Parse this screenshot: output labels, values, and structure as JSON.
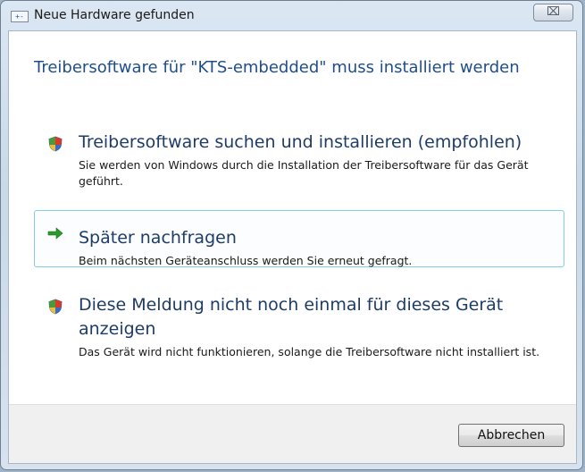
{
  "window": {
    "title": "Neue Hardware gefunden",
    "close_glyph": "⌧"
  },
  "heading": "Treibersoftware für \"KTS-embedded\" muss installiert werden",
  "options": [
    {
      "title": "Treibersoftware suchen und installieren (empfohlen)",
      "description": "Sie werden von Windows durch die Installation der Treibersoftware für das Gerät geführt.",
      "icon": "shield-icon"
    },
    {
      "title": "Später nachfragen",
      "description": "Beim nächsten Geräteanschluss werden Sie erneut gefragt.",
      "icon": "green-arrow-icon"
    },
    {
      "title": "Diese Meldung nicht noch einmal für dieses Gerät anzeigen",
      "description": "Das Gerät wird nicht funktionieren, solange die Treibersoftware nicht installiert ist.",
      "icon": "shield-icon"
    }
  ],
  "footer": {
    "cancel_label": "Abbrechen"
  },
  "colors": {
    "heading": "#1f4e8c",
    "hover_border": "#7fcfe7",
    "arrow": "#2a9a2a"
  }
}
